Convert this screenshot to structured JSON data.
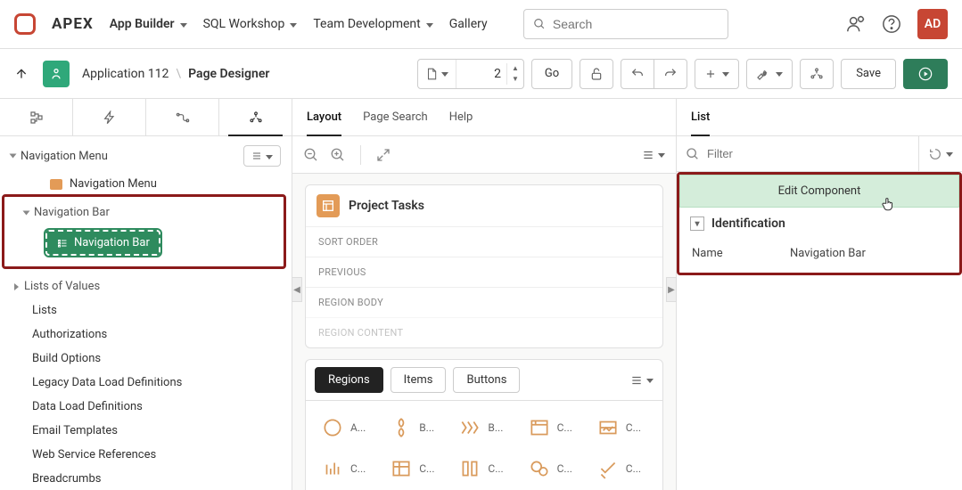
{
  "brand": "APEX",
  "nav": {
    "app_builder": "App Builder",
    "sql_workshop": "SQL Workshop",
    "team_dev": "Team Development",
    "gallery": "Gallery"
  },
  "search": {
    "placeholder": "Search"
  },
  "avatar": "AD",
  "subheader": {
    "app_label": "Application 112",
    "page_designer": "Page Designer",
    "page_number": "2",
    "go": "Go",
    "save": "Save"
  },
  "left_tree": {
    "nav_menu_group": "Navigation Menu",
    "nav_menu_item": "Navigation Menu",
    "nav_bar_group": "Navigation Bar",
    "nav_bar_item": "Navigation Bar",
    "lov_group": "Lists of Values",
    "items": [
      "Lists",
      "Authorizations",
      "Build Options",
      "Legacy Data Load Definitions",
      "Data Load Definitions",
      "Email Templates",
      "Web Service References",
      "Breadcrumbs"
    ]
  },
  "mid": {
    "tabs": {
      "layout": "Layout",
      "page_search": "Page Search",
      "help": "Help"
    },
    "region_title": "Project Tasks",
    "slots": [
      "SORT ORDER",
      "PREVIOUS",
      "REGION BODY",
      "REGION CONTENT"
    ],
    "gallery_tabs": {
      "regions": "Regions",
      "items": "Items",
      "buttons": "Buttons"
    },
    "gallery_items": [
      "A...",
      "B...",
      "B...",
      "C...",
      "C...",
      "C...",
      "C...",
      "C...",
      "C...",
      "C..."
    ]
  },
  "right": {
    "tab": "List",
    "filter_placeholder": "Filter",
    "edit_component": "Edit Component",
    "section": "Identification",
    "prop_name_label": "Name",
    "prop_name_value": "Navigation Bar"
  }
}
